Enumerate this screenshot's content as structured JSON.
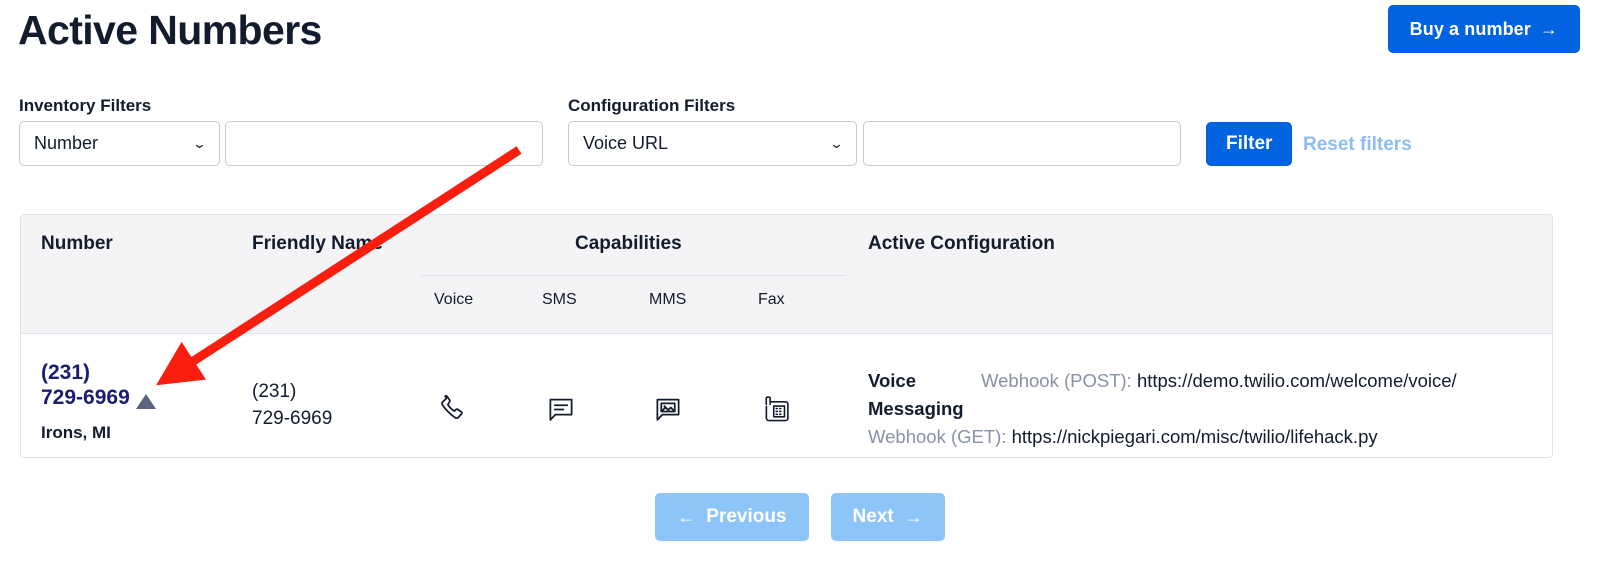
{
  "header": {
    "title": "Active Numbers",
    "buy_button": {
      "label": "Buy a number",
      "arrow": "→"
    }
  },
  "filters": {
    "inventory_label": "Inventory Filters",
    "configuration_label": "Configuration Filters",
    "inventory_select": {
      "value": "Number",
      "chevron": "⌄"
    },
    "inventory_text": {
      "value": "",
      "placeholder": ""
    },
    "configuration_select": {
      "value": "Voice URL",
      "chevron": "⌄"
    },
    "configuration_text": {
      "value": "",
      "placeholder": ""
    },
    "filter_button": "Filter",
    "reset_link": "Reset filters"
  },
  "table": {
    "columns": {
      "number": "Number",
      "friendly_name": "Friendly Name",
      "capabilities": "Capabilities",
      "active_configuration": "Active Configuration"
    },
    "capability_subcolumns": [
      "Voice",
      "SMS",
      "MMS",
      "Fax"
    ],
    "rows": [
      {
        "number_line1": "(231)",
        "number_line2": "729-6969",
        "location": "Irons, MI",
        "friendly_line1": "(231)",
        "friendly_line2": "729-6969",
        "capabilities": {
          "voice_icon": "phone-icon",
          "sms_icon": "chat-bubble-icon",
          "mms_icon": "chat-bubble-image-icon",
          "fax_icon": "fax-icon"
        },
        "config": {
          "voice_label": "Voice",
          "voice_webhook_key": "Webhook (POST):",
          "voice_webhook_url": "https://demo.twilio.com/welcome/voice/",
          "messaging_label": "Messaging",
          "messaging_webhook_key": "Webhook (GET):",
          "messaging_webhook_url": "https://nickpiegari.com/misc/twilio/lifehack.py"
        }
      }
    ]
  },
  "pagination": {
    "previous": {
      "label": "Previous",
      "arrow": "←"
    },
    "next": {
      "label": "Next",
      "arrow": "→"
    }
  },
  "colors": {
    "accent_blue": "#0263e0",
    "muted_blue": "#8ec5f9",
    "link_navy": "#1b1b6f",
    "text_dark": "#121c2d",
    "text_muted": "#8891a5",
    "annotation_red": "#fa1e0e",
    "triangle_slate": "#5a6480",
    "header_bg": "#f4f4f6",
    "border": "#e1e3ea"
  }
}
